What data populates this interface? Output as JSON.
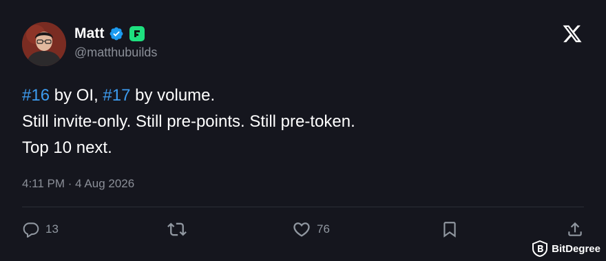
{
  "tweet": {
    "author_name": "Matt",
    "author_handle": "@matthubuilds",
    "text_lines": [
      {
        "hashtag1": "#16",
        "part1": " by OI, ",
        "hashtag2": "#17",
        "part2": " by volume."
      },
      "Still invite-only. Still pre-points. Still pre-token.",
      "Top 10 next."
    ],
    "timestamp": "4:11 PM · 4 Aug 2026"
  },
  "actions": {
    "replies": "13",
    "likes": "76"
  },
  "watermark": "BitDegree",
  "colors": {
    "background": "#15161e",
    "hashtag": "#3d9cf0",
    "verified": "#1d9bf0",
    "affiliate_badge": "#1ee07f",
    "muted": "#8b8f98"
  },
  "icons": [
    "verified-badge-icon",
    "affiliate-badge-icon",
    "x-logo-icon",
    "reply-icon",
    "retweet-icon",
    "like-icon",
    "bookmark-icon",
    "share-icon",
    "bitdegree-logo-icon"
  ]
}
